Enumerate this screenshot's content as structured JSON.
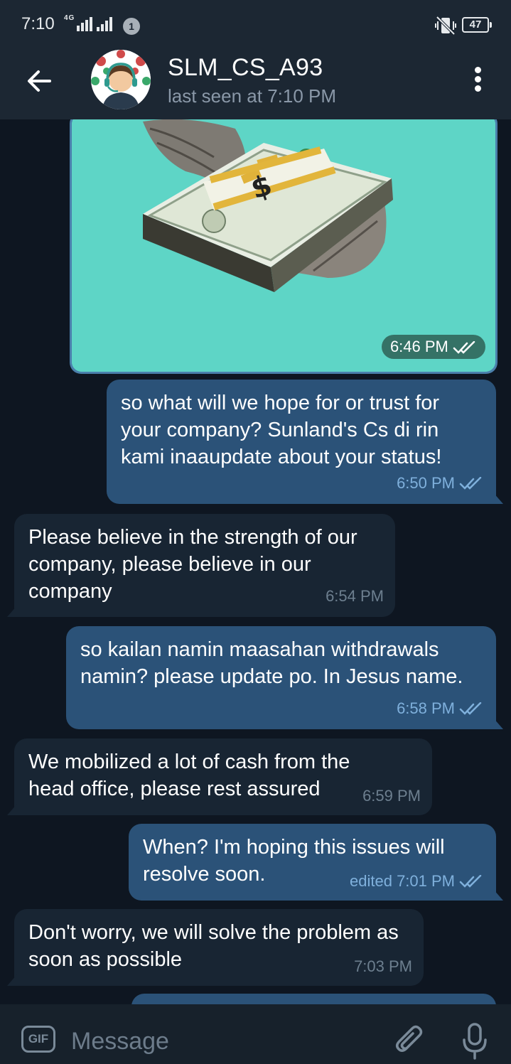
{
  "status_bar": {
    "time": "7:10",
    "network": "4G",
    "notification_count": "1",
    "battery": "47"
  },
  "header": {
    "title": "SLM_CS_A93",
    "subtitle": "last seen at 7:10 PM"
  },
  "messages": [
    {
      "type": "image",
      "direction": "out",
      "time": "6:46 PM",
      "status": "read"
    },
    {
      "type": "text",
      "direction": "out",
      "text": "so what will we hope for or trust for your company? Sunland's Cs di rin kami inaaupdate about your status!",
      "time": "6:50 PM",
      "status": "read"
    },
    {
      "type": "text",
      "direction": "in",
      "text": "Please believe in the strength of our company, please believe in our company",
      "time": "6:54 PM"
    },
    {
      "type": "text",
      "direction": "out",
      "text": "so kailan namin maasahan withdrawals namin? please update po. In Jesus name.",
      "time": "6:58 PM",
      "status": "read"
    },
    {
      "type": "text",
      "direction": "in",
      "text": "We mobilized a lot of cash from the head office, please rest assured",
      "time": "6:59 PM"
    },
    {
      "type": "text",
      "direction": "out",
      "text": "When? I'm hoping this issues will resolve soon.",
      "time": "edited 7:01 PM",
      "status": "read"
    },
    {
      "type": "text",
      "direction": "in",
      "text": "Don't worry, we will solve the problem as soon as possible",
      "time": "7:03 PM"
    }
  ],
  "input": {
    "gif_label": "GIF",
    "placeholder": "Message"
  },
  "colors": {
    "background": "#0e1621",
    "header": "#1c2733",
    "outgoing_bubble": "#2b5278",
    "incoming_bubble": "#182533",
    "read_ticks": "#7fb0dc"
  }
}
